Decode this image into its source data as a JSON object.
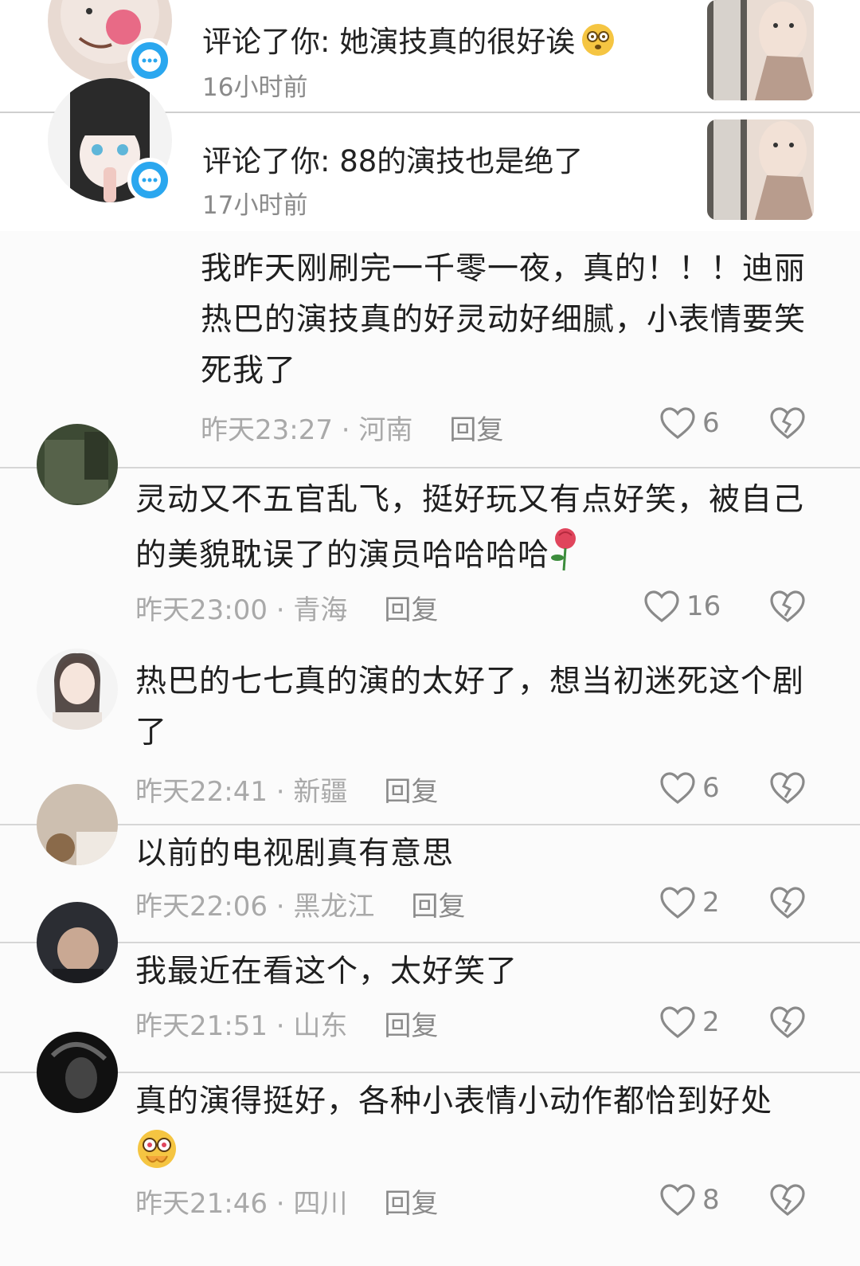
{
  "notifications": [
    {
      "title": "评论了你: 她演技真的很好诶",
      "time": "16小时前"
    },
    {
      "title": "评论了你: 88的演技也是绝了",
      "time": "17小时前"
    }
  ],
  "comments": [
    {
      "text": "我昨天刚刷完一千零一夜，真的！！！迪丽热巴的演技真的好灵动好细腻，小表情要笑死我了",
      "time": "昨天23:27",
      "location": "河南",
      "reply": "回复",
      "likes": "6"
    },
    {
      "text": "灵动又不五官乱飞，挺好玩又有点好笑，被自己的美貌耽误了的演员哈哈哈哈",
      "time": "昨天23:00",
      "location": "青海",
      "reply": "回复",
      "likes": "16"
    },
    {
      "text": "热巴的七七真的演的太好了，想当初迷死这个剧了",
      "time": "昨天22:41",
      "location": "新疆",
      "reply": "回复",
      "likes": "6"
    },
    {
      "text": "以前的电视剧真有意思",
      "time": "昨天22:06",
      "location": "黑龙江",
      "reply": "回复",
      "likes": "2"
    },
    {
      "text": "我最近在看这个，太好笑了",
      "time": "昨天21:51",
      "location": "山东",
      "reply": "回复",
      "likes": "2"
    },
    {
      "text": "真的演得挺好，各种小表情小动作都恰到好处",
      "time": "昨天21:46",
      "location": "四川",
      "reply": "回复",
      "likes": "8"
    }
  ],
  "colors": {
    "badge": "#2aa7ef",
    "meta_text": "#a9a9a9",
    "rose": "#e0455c"
  }
}
